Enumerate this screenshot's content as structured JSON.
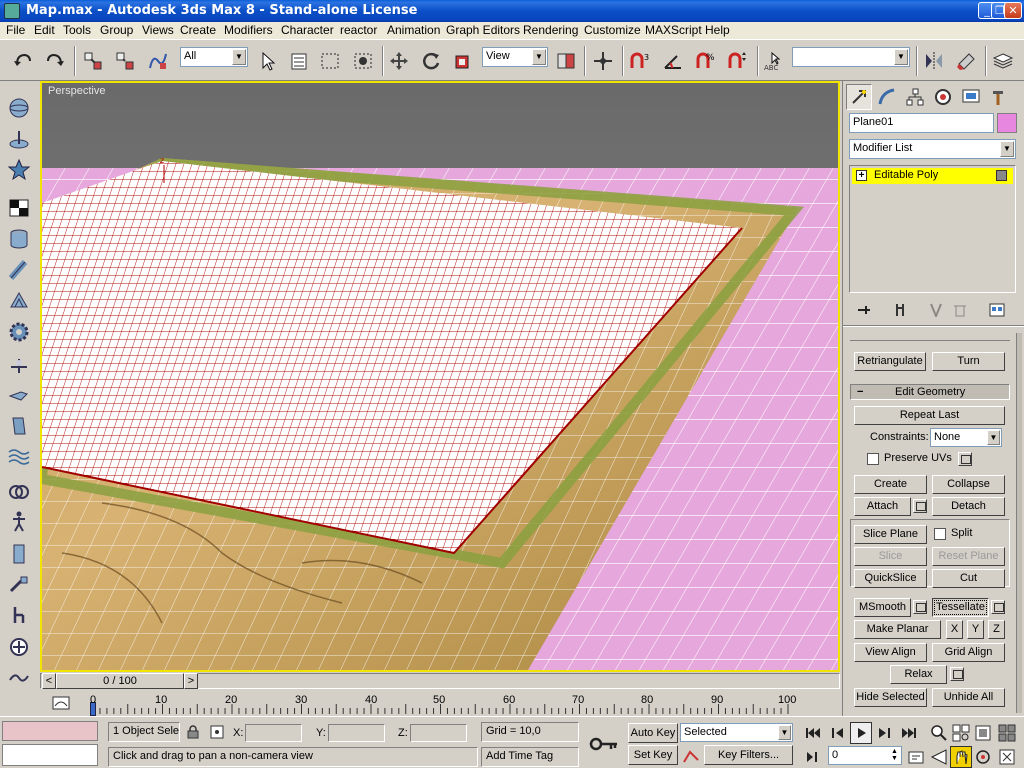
{
  "window": {
    "title": "Map.max - Autodesk 3ds Max 8  - Stand-alone License",
    "minimize": "_",
    "maximize": "❐",
    "close": "✕"
  },
  "menu": [
    "File",
    "Edit",
    "Tools",
    "Group",
    "Views",
    "Create",
    "Modifiers",
    "Character",
    "reactor",
    "Animation",
    "Graph Editors",
    "Rendering",
    "Customize",
    "MAXScript",
    "Help"
  ],
  "toolbar": {
    "selection_filter": "All",
    "ref_coord": "View",
    "named_selection": ""
  },
  "viewport": {
    "label": "Perspective",
    "gizmo_axis": "z"
  },
  "command_panel": {
    "object_name": "Plane01",
    "object_color": "#e887e0",
    "modifier_list": "Modifier List",
    "stack_item": "Editable Poly",
    "stack_expand": "+",
    "retriangulate": "Retriangulate",
    "turn": "Turn",
    "rollout_title": "Edit Geometry",
    "rollout_toggle": "−",
    "repeat_last": "Repeat Last",
    "constraints_label": "Constraints:",
    "constraints_value": "None",
    "preserve_uvs": "Preserve UVs",
    "create": "Create",
    "collapse": "Collapse",
    "attach": "Attach",
    "detach": "Detach",
    "slice_plane": "Slice Plane",
    "split": "Split",
    "slice": "Slice",
    "reset_plane": "Reset Plane",
    "quickslice": "QuickSlice",
    "cut": "Cut",
    "msmooth": "MSmooth",
    "tessellate": "Tessellate",
    "make_planar": "Make Planar",
    "x": "X",
    "y": "Y",
    "z": "Z",
    "view_align": "View Align",
    "grid_align": "Grid Align",
    "relax": "Relax",
    "hide_selected": "Hide Selected",
    "unhide_all": "Unhide All"
  },
  "time_slider": {
    "frame": "0 / 100",
    "prev": "<",
    "next": ">"
  },
  "trackbar": {
    "ticks": [
      "0",
      "10",
      "20",
      "30",
      "40",
      "50",
      "60",
      "70",
      "80",
      "90",
      "100"
    ]
  },
  "status": {
    "selection": "1 Object Sele",
    "x_label": "X:",
    "y_label": "Y:",
    "z_label": "Z:",
    "grid": "Grid = 10,0",
    "prompt": "Click and drag to pan a non-camera view",
    "add_time_tag": "Add Time Tag",
    "auto_key": "Auto Key",
    "set_key": "Set Key",
    "key_mode": "Selected",
    "key_filters": "Key Filters...",
    "frame_field": "0"
  },
  "colors": {
    "title_bar": "#0a5fd8",
    "viewport_border": "#f0e400",
    "stack_highlight": "#ffff00",
    "plane_pink": "#e6a8dc",
    "mesh_red": "#b00000"
  }
}
